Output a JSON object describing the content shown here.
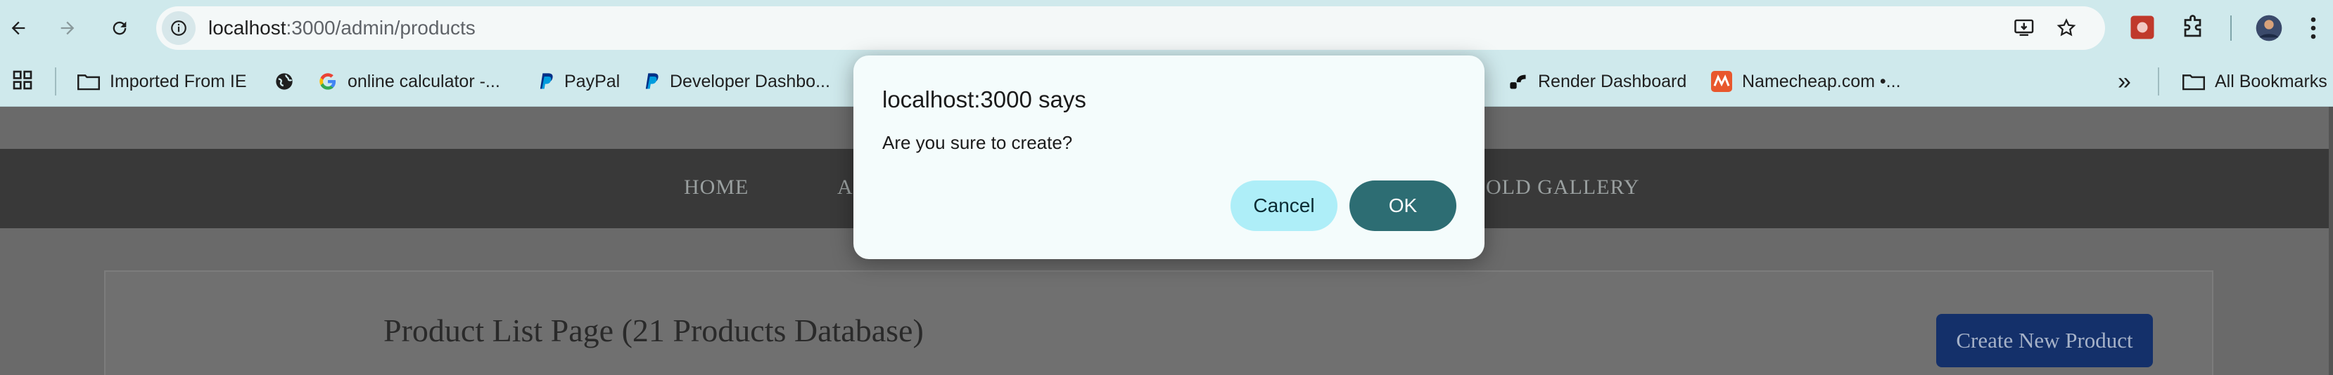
{
  "browser": {
    "url_host": "localhost",
    "url_path": ":3000/admin/products",
    "bookmarks": [
      {
        "label": "Imported From IE",
        "icon": "folder-icon"
      },
      {
        "label": "",
        "icon": "globe-icon"
      },
      {
        "label": "online calculator -...",
        "icon": "google-icon"
      },
      {
        "label": "PayPal",
        "icon": "paypal-icon"
      },
      {
        "label": "Developer Dashbo...",
        "icon": "paypal-icon"
      },
      {
        "label": "Render Dashboard",
        "icon": "render-icon"
      },
      {
        "label": "Namecheap.com •...",
        "icon": "namecheap-icon"
      }
    ],
    "overflow": "»",
    "all_bookmarks": "All Bookmarks"
  },
  "site": {
    "nav": [
      "HOME",
      "A",
      "OLD GALLERY"
    ],
    "page_title": "Product List Page (21 Products Database)",
    "create_button": "Create New Product"
  },
  "dialog": {
    "title": "localhost:3000 says",
    "message": "Are you sure to create?",
    "cancel": "Cancel",
    "ok": "OK"
  },
  "colors": {
    "chrome": "#cfe9ec",
    "nav": "#393939",
    "dialog_ok": "#2d6d73",
    "dialog_cancel": "#aeeef8",
    "create_button": "#14306a"
  }
}
